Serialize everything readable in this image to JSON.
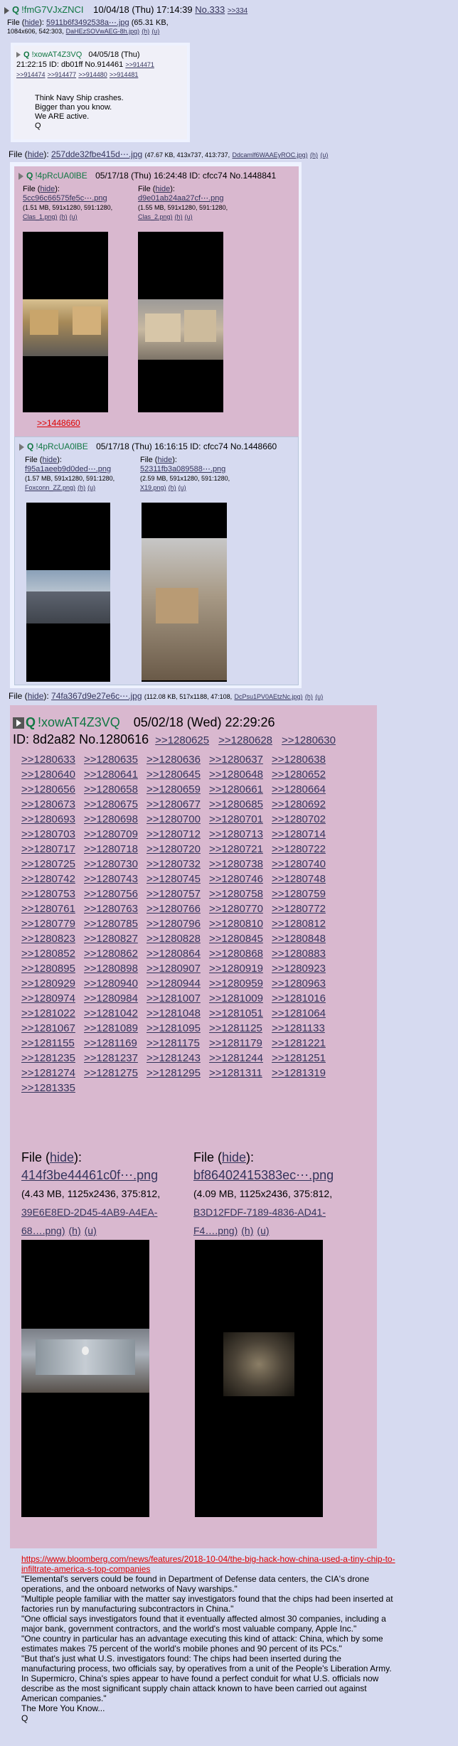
{
  "op": {
    "trip": "!fmG7VJxZNCI",
    "date": "10/04/18 (Thu) 17:14:39",
    "no": "No.333",
    "backlink": ">>334",
    "file_label": "File",
    "hide": "hide",
    "file_name": "5911b6f3492538a⋯.jpg",
    "file_meta1": "(65.31 KB,",
    "file_meta2": "1084x606, 542:303,",
    "file_orig": "DaHEzSOVwAEG-8h.jpg)",
    "h": "(h)",
    "u": "(u)"
  },
  "nested1": {
    "name": "!xowAT4Z3VQ",
    "date": "04/05/18 (Thu)",
    "time_id": "21:22:15 ID: db01ff No.914461",
    "refs1": [
      ">>914471"
    ],
    "refs2": [
      ">>914474",
      ">>914477",
      ">>914480",
      ">>914481"
    ],
    "lines": [
      "Think Navy Ship crashes.",
      "Bigger than you know.",
      "We ARE active.",
      "Q"
    ]
  },
  "file2": {
    "label": "File",
    "hide": "hide",
    "name": "257dde32fbe415d⋯.jpg",
    "meta": "(47.67 KB, 413x737, 413:737,",
    "orig": "Ddcamlf6WAAEyROC.jpg)",
    "h": "(h)",
    "u": "(u)"
  },
  "nested2": {
    "name": "!4pRcUA0lBE",
    "datetime": "05/17/18 (Thu) 16:24:48 ID: cfcc74 No.1448841",
    "fileA": {
      "label": "File",
      "hide": "hide",
      "name": "5cc96c66575fe5c⋯.png",
      "meta": "(1.51 MB, 591x1280, 591:1280,",
      "orig": "Clas_1.png)",
      "h": "(h)",
      "u": "(u)"
    },
    "fileB": {
      "label": "File",
      "hide": "hide",
      "name": "d9e01ab24aa27cf⋯.png",
      "meta": "(1.55 MB, 591x1280, 591:1280,",
      "orig": "Clas_2.png)",
      "h": "(h)",
      "u": "(u)"
    },
    "quote": ">>1448660"
  },
  "nested3": {
    "name": "!4pRcUA0lBE",
    "datetime": "05/17/18 (Thu) 16:16:15 ID: cfcc74 No.1448660",
    "fileA": {
      "label": "File",
      "hide": "hide",
      "name": "f95a1aeeb9d0ded⋯.png",
      "meta": "(1.57 MB, 591x1280, 591:1280,",
      "orig": "Foxconn_ZZ.png)",
      "h": "(h)",
      "u": "(u)"
    },
    "fileB": {
      "label": "File",
      "hide": "hide",
      "name": "52311fb3a089588⋯.png",
      "meta": "(2.59 MB, 591x1280, 591:1280,",
      "orig": "X19.png)",
      "h": "(h)",
      "u": "(u)"
    }
  },
  "file3": {
    "label": "File",
    "hide": "hide",
    "name": "74fa367d9e27e6c⋯.jpg",
    "meta": "(112.08 KB, 517x1188, 47:108,",
    "orig": "DcPsu1PV0AEtzNc.jpg)",
    "h": "(h)",
    "u": "(u)"
  },
  "big": {
    "name": "!xowAT4Z3VQ",
    "date": "05/02/18 (Wed) 22:29:26",
    "id_line": "ID: 8d2a82 No.1280616",
    "head_refs": [
      ">>1280625",
      ">>1280628",
      ">>1280630"
    ],
    "refs": [
      ">>1280633",
      ">>1280635",
      ">>1280636",
      ">>1280637",
      ">>1280638",
      ">>1280640",
      ">>1280641",
      ">>1280645",
      ">>1280648",
      ">>1280652",
      ">>1280656",
      ">>1280658",
      ">>1280659",
      ">>1280661",
      ">>1280664",
      ">>1280673",
      ">>1280675",
      ">>1280677",
      ">>1280685",
      ">>1280692",
      ">>1280693",
      ">>1280698",
      ">>1280700",
      ">>1280701",
      ">>1280702",
      ">>1280703",
      ">>1280709",
      ">>1280712",
      ">>1280713",
      ">>1280714",
      ">>1280717",
      ">>1280718",
      ">>1280720",
      ">>1280721",
      ">>1280722",
      ">>1280725",
      ">>1280730",
      ">>1280732",
      ">>1280738",
      ">>1280740",
      ">>1280742",
      ">>1280743",
      ">>1280745",
      ">>1280746",
      ">>1280748",
      ">>1280753",
      ">>1280756",
      ">>1280757",
      ">>1280758",
      ">>1280759",
      ">>1280761",
      ">>1280763",
      ">>1280766",
      ">>1280770",
      ">>1280772",
      ">>1280779",
      ">>1280785",
      ">>1280796",
      ">>1280810",
      ">>1280812",
      ">>1280823",
      ">>1280827",
      ">>1280828",
      ">>1280845",
      ">>1280848",
      ">>1280852",
      ">>1280862",
      ">>1280864",
      ">>1280868",
      ">>1280883",
      ">>1280895",
      ">>1280898",
      ">>1280907",
      ">>1280919",
      ">>1280923",
      ">>1280929",
      ">>1280940",
      ">>1280944",
      ">>1280959",
      ">>1280963",
      ">>1280974",
      ">>1280984",
      ">>1281007",
      ">>1281009",
      ">>1281016",
      ">>1281022",
      ">>1281042",
      ">>1281048",
      ">>1281051",
      ">>1281064",
      ">>1281067",
      ">>1281089",
      ">>1281095",
      ">>1281125",
      ">>1281133",
      ">>1281155",
      ">>1281169",
      ">>1281175",
      ">>1281179",
      ">>1281221",
      ">>1281235",
      ">>1281237",
      ">>1281243",
      ">>1281244",
      ">>1281251",
      ">>1281274",
      ">>1281275",
      ">>1281295",
      ">>1281311",
      ">>1281319",
      ">>1281335"
    ],
    "fileA": {
      "label": "File",
      "hide": "hide",
      "name": "414f3be44461c0f⋯.png",
      "meta": "(4.43 MB, 1125x2436, 375:812,",
      "orig1": "39E6E8ED-2D45-4AB9-A4EA-",
      "orig2": "68….png)",
      "h": "(h)",
      "u": "(u)"
    },
    "fileB": {
      "label": "File",
      "hide": "hide",
      "name": "bf86402415383ec⋯.png",
      "meta": "(4.09 MB, 1125x2436, 375:812,",
      "orig1": "B3D12FDF-7189-4836-AD41-",
      "orig2": "F4….png)",
      "h": "(h)",
      "u": "(u)"
    }
  },
  "body": {
    "url1": "https://www.bloomberg.com/news/features/2018-10-04/the-big-hack-how-china-used-a-tiny-chip-to-",
    "url2": "infiltrate-america-s-top-companies",
    "lines": [
      "\"Elemental's servers could be found in Department of Defense data centers, the CIA's drone",
      "operations, and the onboard networks of Navy warships.\"",
      "\"Multiple people familiar with the matter say investigators found that the chips had been inserted at",
      "factories run by manufacturing subcontractors in China.\"",
      "\"One official says investigators found that it eventually affected almost 30 companies, including a",
      "major bank, government contractors, and the world's most valuable company, Apple Inc.\"",
      "\"One country in particular has an advantage executing this kind of attack: China, which by some",
      "estimates makes 75 percent of the world's mobile phones and 90 percent of its PCs.\"",
      "\"But that's just what U.S. investigators found: The chips had been inserted during the",
      "manufacturing process, two officials say, by operatives from a unit of the People's Liberation Army.",
      "In Supermicro, China's spies appear to have found a perfect conduit for what U.S. officials now",
      "describe as the most significant supply chain attack known to have been carried out against",
      "American companies.\"",
      "The More You Know...",
      "Q"
    ]
  }
}
